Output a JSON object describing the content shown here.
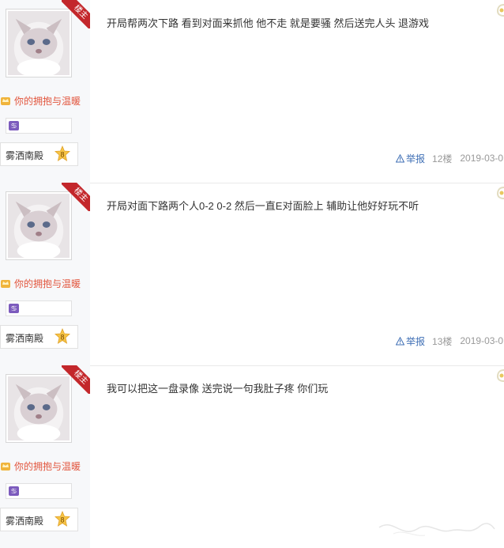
{
  "op_label": "楼主",
  "posts": [
    {
      "badge": "你的拥抱与温暖",
      "username": "雾洒南殿",
      "level": "8",
      "content": "开局帮两次下路 看到对面来抓他 他不走 就是要骚 然后送完人头 退游戏",
      "report": "举报",
      "floor": "12楼",
      "date": "2019-03-0"
    },
    {
      "badge": "你的拥抱与温暖",
      "username": "雾洒南殿",
      "level": "8",
      "content": "开局对面下路两个人0-2 0-2 然后一直E对面脸上 辅助让他好好玩不听",
      "report": "举报",
      "floor": "13楼",
      "date": "2019-03-0"
    },
    {
      "badge": "你的拥抱与温暖",
      "username": "雾洒南殿",
      "level": "8",
      "content": "我可以把这一盘录像 送完说一句我肚子疼 你们玩"
    }
  ],
  "colors": {
    "ribbon": "#c3272b",
    "badge_text": "#e2553d",
    "link": "#3f6fb5",
    "meta": "#999999",
    "sidebar_bg": "#f7f8fa"
  },
  "icons": {
    "level": "star-level-icon",
    "report": "warning-triangle-icon",
    "constellation": "cancer-icon",
    "badge": "crown-icon"
  }
}
